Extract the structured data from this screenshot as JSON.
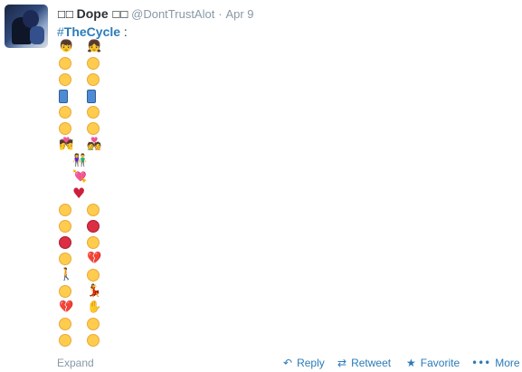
{
  "tweet": {
    "name_icons_left": "☐☐",
    "fullname": "Dope",
    "name_icons_right": "☐☐",
    "screen_name": "@DontTrustAlot",
    "separator": "·",
    "time": "Apr 9",
    "hashtag_hash": "#",
    "hashtag_text": "TheCycle",
    "after_hashtag": " :"
  },
  "emoji_grid": [
    [
      "man",
      "woman"
    ],
    [
      "flushed-face",
      "smiling-face"
    ],
    [
      "winking-face",
      "blushing-face"
    ],
    [
      "mobile-phone",
      "phone-calling"
    ],
    [
      "smirking-face",
      "grinning-face"
    ],
    [
      "face-blowing-kiss",
      "heart-eyes-face"
    ],
    [
      "kiss",
      "couple-with-heart"
    ],
    [
      "couple",
      null
    ],
    [
      "heart-with-arrow",
      null
    ],
    [
      "red-heart",
      null
    ],
    [
      "relieved-face",
      "blushing-face"
    ],
    [
      "unamused-face",
      "angry-face"
    ],
    [
      "pouting-face",
      "crying-face"
    ],
    [
      "face-with-steam",
      "broken-heart"
    ],
    [
      "person-walking",
      "tired-face"
    ],
    [
      "flushed-face",
      "woman-dancing"
    ],
    [
      "broken-heart",
      "raised-hand"
    ],
    [
      "pensive-face",
      "relieved-face"
    ],
    [
      "sleepy-face",
      "smiling-face"
    ]
  ],
  "emoji_glyphs": {
    "man": "👦",
    "woman": "👧",
    "couple": "👫",
    "heart-with-arrow": "💘",
    "red-heart": "♥",
    "broken-heart": "💔",
    "person-walking": "🚶",
    "woman-dancing": "💃",
    "raised-hand": "✋",
    "kiss": "💏",
    "couple-with-heart": "💑"
  },
  "footer": {
    "expand": "Expand",
    "reply": "Reply",
    "retweet": "Retweet",
    "favorite": "Favorite",
    "more": "More"
  },
  "icons": {
    "reply": "reply-icon",
    "retweet": "retweet-icon",
    "favorite": "star-icon",
    "more": "more-dots-icon"
  },
  "colors": {
    "link": "#2b7bb9",
    "secondary_text": "#8899a6",
    "primary_text": "#292f33"
  }
}
